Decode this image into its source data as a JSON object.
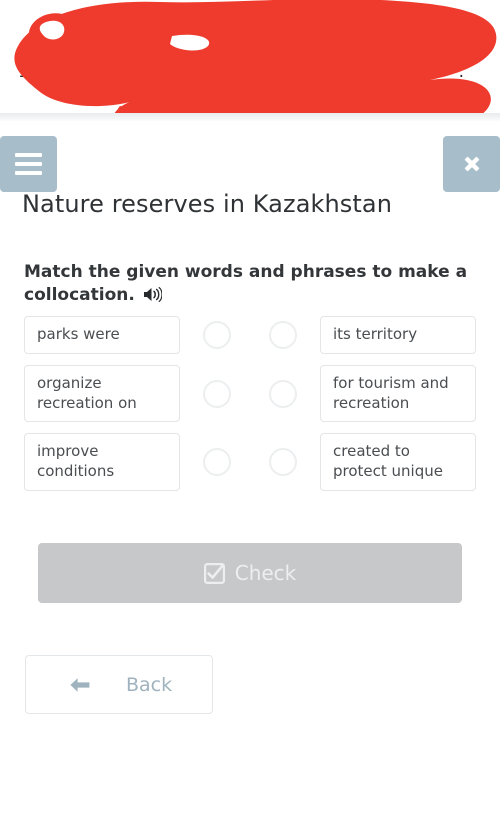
{
  "banner": {
    "left_fragment": "1",
    "right_fragment": ".",
    "redaction_color": "#ee3b2e",
    "note": "banner text obscured by red redaction scribble"
  },
  "header": {
    "menu_icon": "hamburger-icon",
    "close_icon": "close-icon",
    "button_color": "#a7bdca",
    "page_title": "Nature reserves in Kazakhstan"
  },
  "task": {
    "instruction": "Match the given words and phrases to make a collocation.",
    "audio_icon": "speaker-icon",
    "rows": [
      {
        "left": "parks were",
        "right": "its territory"
      },
      {
        "left": "organize recreation on",
        "right": "for tourism and recreation"
      },
      {
        "left": "improve conditions",
        "right": "created to protect unique"
      }
    ]
  },
  "actions": {
    "check_label": "Check",
    "check_icon": "checkbox-checked-icon",
    "check_disabled_color": "#c6c8ca",
    "back_label": "Back",
    "back_icon": "arrow-left-icon",
    "back_text_color": "#9fb3bf"
  }
}
